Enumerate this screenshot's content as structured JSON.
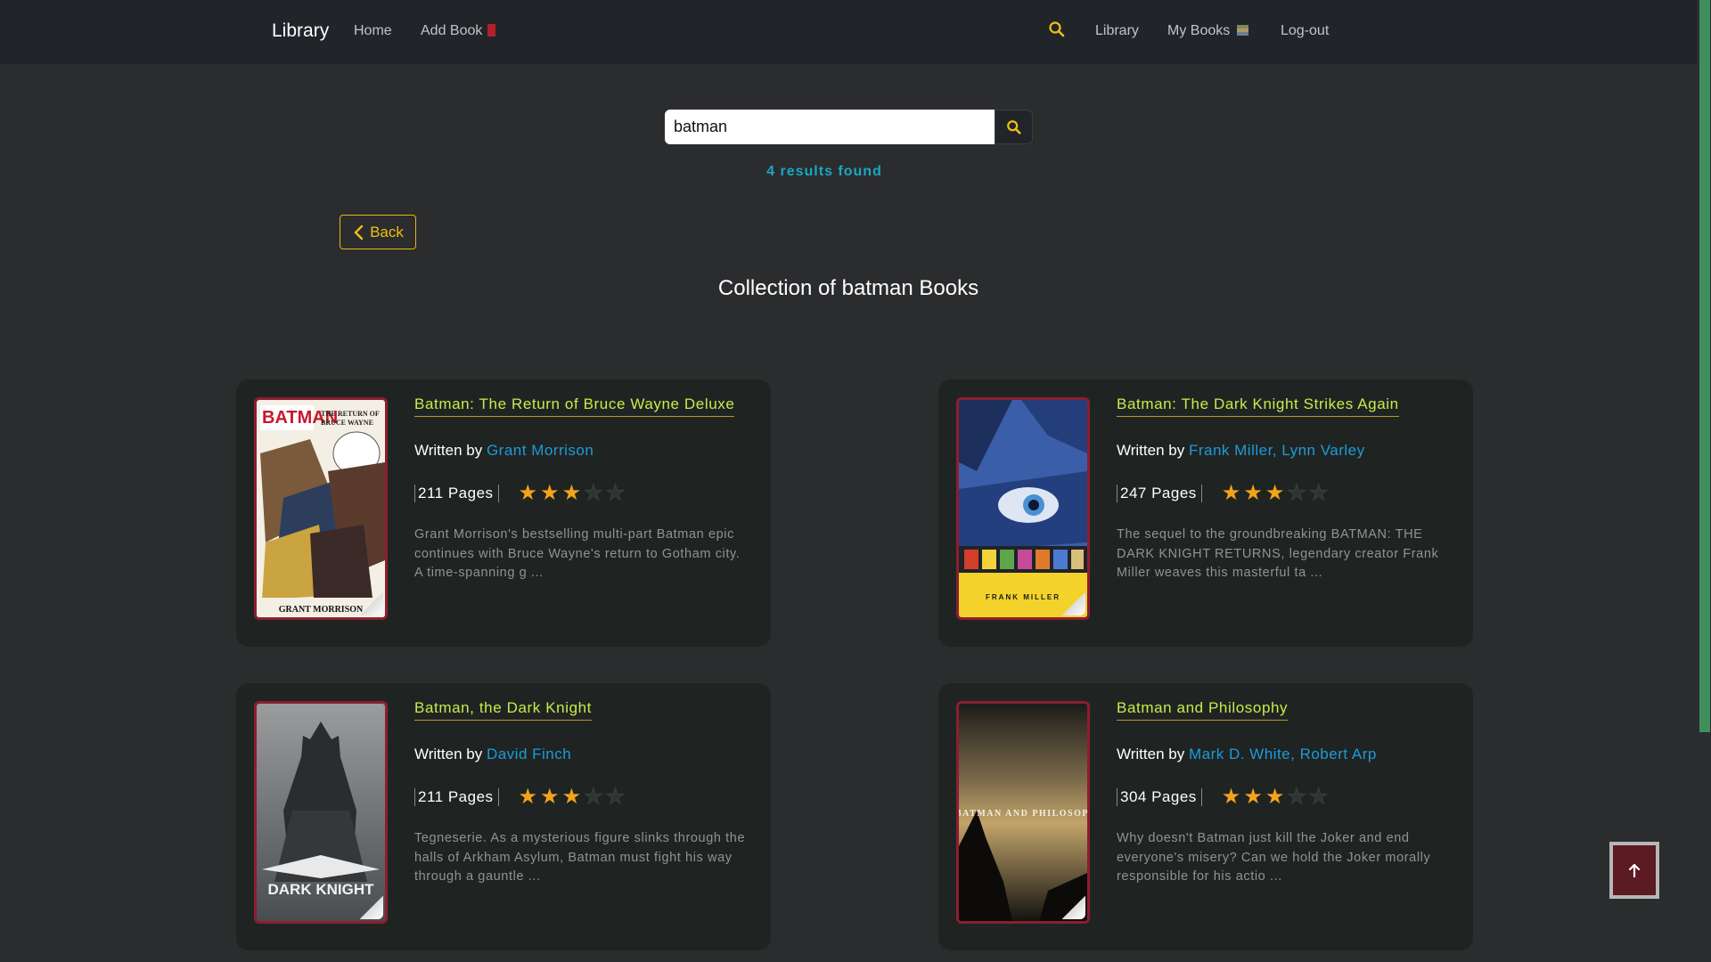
{
  "nav": {
    "brand": "Library",
    "home": "Home",
    "add_book": "Add Book",
    "library": "Library",
    "my_books": "My Books",
    "logout": "Log-out"
  },
  "search": {
    "value": "batman",
    "placeholder": ""
  },
  "results_text": "4 results found",
  "back_label": "Back",
  "page_title": "Collection of batman Books",
  "colors": {
    "accent": "#c7ec4a",
    "author": "#1e9bd8",
    "star": "#f3a41a",
    "results": "#18a8c2",
    "back": "#f2bf14"
  },
  "books": [
    {
      "title": "Batman: The Return of Bruce Wayne Deluxe",
      "written_by": "Written by",
      "authors": "Grant Morrison",
      "pages": "211 Pages",
      "rating": 3,
      "rating_max": 5,
      "description": "Grant Morrison's bestselling multi-part Batman epic continues with Bruce Wayne's return to Gotham city. A time-spanning g ...",
      "cover_text": "GRANT MORRISON"
    },
    {
      "title": "Batman: The Dark Knight Strikes Again",
      "written_by": "Written by",
      "authors": "Frank Miller, Lynn Varley",
      "pages": "247 Pages",
      "rating": 3,
      "rating_max": 5,
      "description": "The sequel to the groundbreaking BATMAN: THE DARK KNIGHT RETURNS, legendary creator Frank Miller weaves this masterful ta ...",
      "cover_text": "FRANK MILLER"
    },
    {
      "title": "Batman, the Dark Knight",
      "written_by": "Written by",
      "authors": "David Finch",
      "pages": "211 Pages",
      "rating": 3,
      "rating_max": 5,
      "description": "Tegneserie. As a mysterious figure slinks through the halls of Arkham Asylum, Batman must fight his way through a gauntle ...",
      "cover_text": "DARK KNIGHT"
    },
    {
      "title": "Batman and Philosophy",
      "written_by": "Written by",
      "authors": "Mark D. White, Robert Arp",
      "pages": "304 Pages",
      "rating": 3,
      "rating_max": 5,
      "description": "Why doesn't Batman just kill the Joker and end everyone's misery? Can we hold the Joker morally responsible for his actio ...",
      "cover_text": "BATMAN AND PHILOSOPHY"
    }
  ]
}
